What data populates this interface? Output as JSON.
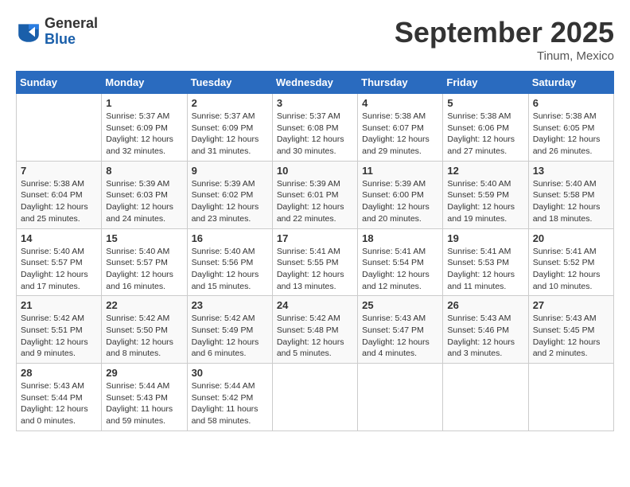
{
  "header": {
    "logo": {
      "general": "General",
      "blue": "Blue"
    },
    "title": "September 2025",
    "location": "Tinum, Mexico"
  },
  "days_of_week": [
    "Sunday",
    "Monday",
    "Tuesday",
    "Wednesday",
    "Thursday",
    "Friday",
    "Saturday"
  ],
  "weeks": [
    [
      {
        "day": "",
        "info": ""
      },
      {
        "day": "1",
        "info": "Sunrise: 5:37 AM\nSunset: 6:09 PM\nDaylight: 12 hours\nand 32 minutes."
      },
      {
        "day": "2",
        "info": "Sunrise: 5:37 AM\nSunset: 6:09 PM\nDaylight: 12 hours\nand 31 minutes."
      },
      {
        "day": "3",
        "info": "Sunrise: 5:37 AM\nSunset: 6:08 PM\nDaylight: 12 hours\nand 30 minutes."
      },
      {
        "day": "4",
        "info": "Sunrise: 5:38 AM\nSunset: 6:07 PM\nDaylight: 12 hours\nand 29 minutes."
      },
      {
        "day": "5",
        "info": "Sunrise: 5:38 AM\nSunset: 6:06 PM\nDaylight: 12 hours\nand 27 minutes."
      },
      {
        "day": "6",
        "info": "Sunrise: 5:38 AM\nSunset: 6:05 PM\nDaylight: 12 hours\nand 26 minutes."
      }
    ],
    [
      {
        "day": "7",
        "info": "Sunrise: 5:38 AM\nSunset: 6:04 PM\nDaylight: 12 hours\nand 25 minutes."
      },
      {
        "day": "8",
        "info": "Sunrise: 5:39 AM\nSunset: 6:03 PM\nDaylight: 12 hours\nand 24 minutes."
      },
      {
        "day": "9",
        "info": "Sunrise: 5:39 AM\nSunset: 6:02 PM\nDaylight: 12 hours\nand 23 minutes."
      },
      {
        "day": "10",
        "info": "Sunrise: 5:39 AM\nSunset: 6:01 PM\nDaylight: 12 hours\nand 22 minutes."
      },
      {
        "day": "11",
        "info": "Sunrise: 5:39 AM\nSunset: 6:00 PM\nDaylight: 12 hours\nand 20 minutes."
      },
      {
        "day": "12",
        "info": "Sunrise: 5:40 AM\nSunset: 5:59 PM\nDaylight: 12 hours\nand 19 minutes."
      },
      {
        "day": "13",
        "info": "Sunrise: 5:40 AM\nSunset: 5:58 PM\nDaylight: 12 hours\nand 18 minutes."
      }
    ],
    [
      {
        "day": "14",
        "info": "Sunrise: 5:40 AM\nSunset: 5:57 PM\nDaylight: 12 hours\nand 17 minutes."
      },
      {
        "day": "15",
        "info": "Sunrise: 5:40 AM\nSunset: 5:57 PM\nDaylight: 12 hours\nand 16 minutes."
      },
      {
        "day": "16",
        "info": "Sunrise: 5:40 AM\nSunset: 5:56 PM\nDaylight: 12 hours\nand 15 minutes."
      },
      {
        "day": "17",
        "info": "Sunrise: 5:41 AM\nSunset: 5:55 PM\nDaylight: 12 hours\nand 13 minutes."
      },
      {
        "day": "18",
        "info": "Sunrise: 5:41 AM\nSunset: 5:54 PM\nDaylight: 12 hours\nand 12 minutes."
      },
      {
        "day": "19",
        "info": "Sunrise: 5:41 AM\nSunset: 5:53 PM\nDaylight: 12 hours\nand 11 minutes."
      },
      {
        "day": "20",
        "info": "Sunrise: 5:41 AM\nSunset: 5:52 PM\nDaylight: 12 hours\nand 10 minutes."
      }
    ],
    [
      {
        "day": "21",
        "info": "Sunrise: 5:42 AM\nSunset: 5:51 PM\nDaylight: 12 hours\nand 9 minutes."
      },
      {
        "day": "22",
        "info": "Sunrise: 5:42 AM\nSunset: 5:50 PM\nDaylight: 12 hours\nand 8 minutes."
      },
      {
        "day": "23",
        "info": "Sunrise: 5:42 AM\nSunset: 5:49 PM\nDaylight: 12 hours\nand 6 minutes."
      },
      {
        "day": "24",
        "info": "Sunrise: 5:42 AM\nSunset: 5:48 PM\nDaylight: 12 hours\nand 5 minutes."
      },
      {
        "day": "25",
        "info": "Sunrise: 5:43 AM\nSunset: 5:47 PM\nDaylight: 12 hours\nand 4 minutes."
      },
      {
        "day": "26",
        "info": "Sunrise: 5:43 AM\nSunset: 5:46 PM\nDaylight: 12 hours\nand 3 minutes."
      },
      {
        "day": "27",
        "info": "Sunrise: 5:43 AM\nSunset: 5:45 PM\nDaylight: 12 hours\nand 2 minutes."
      }
    ],
    [
      {
        "day": "28",
        "info": "Sunrise: 5:43 AM\nSunset: 5:44 PM\nDaylight: 12 hours\nand 0 minutes."
      },
      {
        "day": "29",
        "info": "Sunrise: 5:44 AM\nSunset: 5:43 PM\nDaylight: 11 hours\nand 59 minutes."
      },
      {
        "day": "30",
        "info": "Sunrise: 5:44 AM\nSunset: 5:42 PM\nDaylight: 11 hours\nand 58 minutes."
      },
      {
        "day": "",
        "info": ""
      },
      {
        "day": "",
        "info": ""
      },
      {
        "day": "",
        "info": ""
      },
      {
        "day": "",
        "info": ""
      }
    ]
  ]
}
